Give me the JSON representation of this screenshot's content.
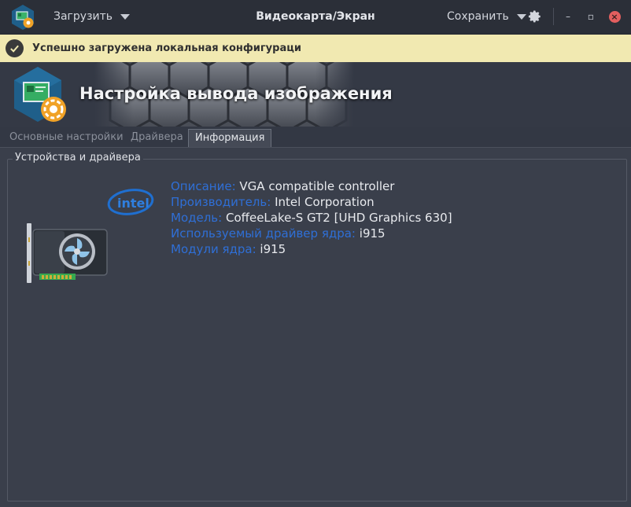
{
  "window": {
    "title": "Видеокарта/Экран",
    "load_label": "Загрузить",
    "save_label": "Сохранить",
    "minimize_glyph": "–",
    "maximize_glyph": "▫",
    "close_glyph": "×"
  },
  "notification": {
    "message": "Успешно загружена локальная конфигураци"
  },
  "banner": {
    "title": "Настройка вывода изображения"
  },
  "tabs": [
    {
      "label": "Основные настройки",
      "active": false
    },
    {
      "label": "Драйвера",
      "active": false
    },
    {
      "label": "Информация",
      "active": true
    }
  ],
  "group": {
    "title": "Устройства и драйвера"
  },
  "device_info": [
    {
      "label": "Описание:",
      "value": "VGA compatible controller"
    },
    {
      "label": "Производитель:",
      "value": "Intel Corporation"
    },
    {
      "label": "Модель:",
      "value": "CoffeeLake-S GT2 [UHD Graphics 630]"
    },
    {
      "label": "Используемый драйвер ядра:",
      "value": "i915"
    },
    {
      "label": "Модули ядра:",
      "value": "i915"
    }
  ],
  "vendor_logo_text": "intel",
  "icons": {
    "app": "display-settings-icon",
    "gpu": "graphics-card-icon",
    "vendor": "intel-logo"
  },
  "colors": {
    "accent_label": "#2f6fd6",
    "notification_bg": "#f1e9b1",
    "close_button": "#e35f5f",
    "background": "#3a3f4b"
  }
}
